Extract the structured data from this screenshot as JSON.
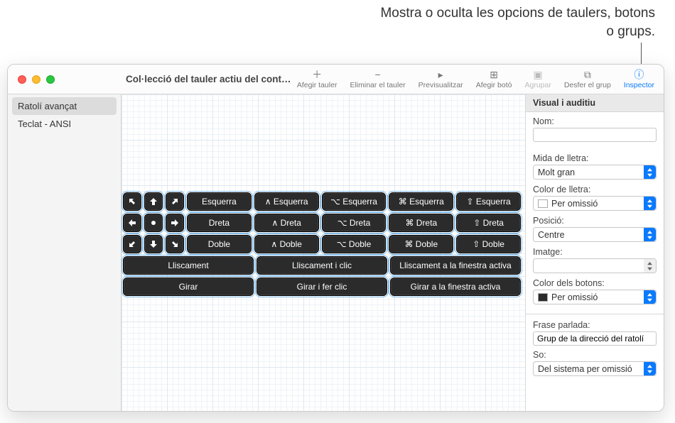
{
  "callout": "Mostra o oculta les opcions de taulers, botons o grups.",
  "window_title": "Col·lecció del tauler actiu del cont…",
  "toolbar": {
    "add_panel": "Afegir tauler",
    "remove_panel": "Eliminar el tauler",
    "preview": "Previsualitzar",
    "add_button": "Afegir botó",
    "group": "Agrupar",
    "ungroup": "Desfer el grup",
    "inspector": "Inspector"
  },
  "sidebar": {
    "items": [
      {
        "label": "Ratolí avançat",
        "selected": true
      },
      {
        "label": "Teclat - ANSI",
        "selected": false
      }
    ]
  },
  "buttons": {
    "row_labels": [
      "Esquerra",
      "Dreta",
      "Doble"
    ],
    "mod_prefixes": [
      "",
      "∧ ",
      "⌥ ",
      "⌘ ",
      "⇧ "
    ],
    "wide_rows": [
      [
        "Lliscament",
        "Lliscament i clic",
        "Lliscament a la finestra activa"
      ],
      [
        "Girar",
        "Girar i fer clic",
        "Girar a la finestra activa"
      ]
    ]
  },
  "inspector": {
    "header": "Visual i auditiu",
    "name_label": "Nom:",
    "name_value": "",
    "font_size_label": "Mida de lletra:",
    "font_size_value": "Molt gran",
    "font_color_label": "Color de lletra:",
    "font_color_value": "Per omissió",
    "position_label": "Posició:",
    "position_value": "Centre",
    "image_label": "Imatge:",
    "image_value": "",
    "button_color_label": "Color dels botons:",
    "button_color_value": "Per omissió",
    "spoken_label": "Frase parlada:",
    "spoken_value": "Grup de la direcció del ratolí",
    "sound_label": "So:",
    "sound_value": "Del sistema per omissió"
  }
}
